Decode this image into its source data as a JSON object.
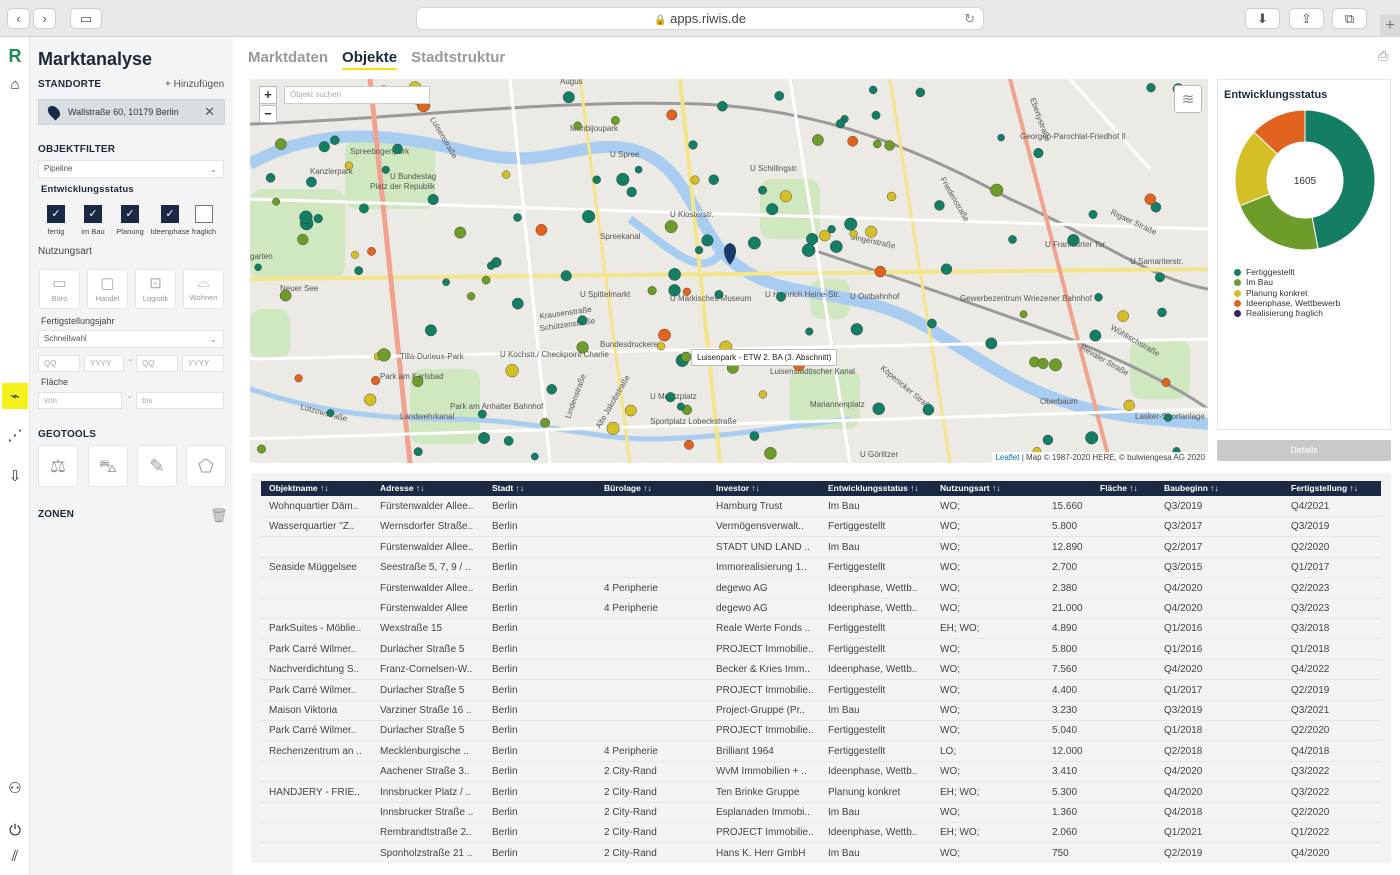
{
  "browser": {
    "url": "apps.riwis.de"
  },
  "sidebar": {
    "title": "Marktanalyse",
    "standorte_label": "STANDORTE",
    "add_label": "+ Hinzufügen",
    "location": "Wallstraße 60, 10179 Berlin",
    "objektfilter_label": "OBJEKTFILTER",
    "pipeline_value": "Pipeline",
    "entwicklungsstatus_label": "Entwicklungsstatus",
    "status_checks": [
      {
        "label": "fertig",
        "checked": true
      },
      {
        "label": "im Bau",
        "checked": true
      },
      {
        "label": "Planung",
        "checked": true
      },
      {
        "label": "Ideenphase",
        "checked": true
      },
      {
        "label": "fraglich",
        "checked": false
      }
    ],
    "nutzungsart_label": "Nutzungsart",
    "usage_tiles": [
      "Büro",
      "Handel",
      "Logistik",
      "Wohnen"
    ],
    "fertigstellungsjahr_label": "Fertigstellungsjahr",
    "schnellwahl_value": "Schnellwahl",
    "qq_placeholder": "QQ",
    "yyyy_placeholder": "YYYY",
    "flaeche_label": "Fläche",
    "von_placeholder": "von",
    "bis_placeholder": "bis",
    "geotools_label": "GEOTOOLS",
    "zonen_label": "ZONEN"
  },
  "tabs": [
    "Marktdaten",
    "Objekte",
    "Stadtstruktur"
  ],
  "active_tab": "Objekte",
  "map": {
    "search_placeholder": "Objekt suchen",
    "zoom_in": "+",
    "zoom_out": "−",
    "tooltip": "Luisenpark - ETW 2. BA (3. Abschnitt)",
    "attribution_leaflet": "Leaflet",
    "attribution_rest": " | Map © 1987-2020 HERE, © bulwiengesa AG 2020",
    "labels": [
      {
        "text": "Luisenstraße"
      },
      {
        "text": "Spreebogenpark"
      },
      {
        "text": "U Bundestag"
      },
      {
        "text": "Kanzlerpark"
      },
      {
        "text": "Platz der Republik"
      },
      {
        "text": "Monbijoupark"
      },
      {
        "text": "U Schillingstr."
      },
      {
        "text": "Friedenstraße"
      },
      {
        "text": "Georgen-Parochial-Friedhof II"
      },
      {
        "text": "Ebertystraße"
      },
      {
        "text": "U Klosterstr."
      },
      {
        "text": "Singerstraße"
      },
      {
        "text": "Rigaer Straße"
      },
      {
        "text": "U Frankfurter Tor"
      },
      {
        "text": "U Samariterstr."
      },
      {
        "text": "Spreekanal"
      },
      {
        "text": "U Spittelmarkt"
      },
      {
        "text": "U Märkisches Museum"
      },
      {
        "text": "U Heinrich Heine-Str."
      },
      {
        "text": "U Ostbahnhof"
      },
      {
        "text": "Gewerbezentrum Wriezener Bahnhof"
      },
      {
        "text": "Wühlischstraße"
      },
      {
        "text": "Neuer See"
      },
      {
        "text": "Krausenstraße"
      },
      {
        "text": "Schützenstraße"
      },
      {
        "text": "Bundesdruckerei"
      },
      {
        "text": "U Kochstr./ Checkpoint Charlie"
      },
      {
        "text": "Tilla-Durieux-Park"
      },
      {
        "text": "Park am Karlsbad"
      },
      {
        "text": "Lützowstraße"
      },
      {
        "text": "Landwehrkanal"
      },
      {
        "text": "Park am Anhalter Bahnhof"
      },
      {
        "text": "U Moritzplatz"
      },
      {
        "text": "Luisenstädtischer Kanal"
      },
      {
        "text": "Mariannenplatz"
      },
      {
        "text": "Köpenicker Straße"
      },
      {
        "text": "Lindenstraße"
      },
      {
        "text": "Alte Jakobstraße"
      },
      {
        "text": "Sportplatz Lobeckstraße"
      },
      {
        "text": "U Görlitzer"
      },
      {
        "text": "Revaler Straße"
      },
      {
        "text": "Lasker-Sportanlage"
      },
      {
        "text": "Oberbaum"
      },
      {
        "text": "Augus"
      },
      {
        "text": "U Spree"
      },
      {
        "text": "garten"
      }
    ]
  },
  "status_panel": {
    "title": "Entwicklungsstatus",
    "total": "1605",
    "legend": [
      {
        "label": "Fertiggestellt",
        "color": "#137e64"
      },
      {
        "label": "Im Bau",
        "color": "#6e9c2a"
      },
      {
        "label": "Planung konkret",
        "color": "#d4bf26"
      },
      {
        "label": "Ideenphase, Wettbewerb",
        "color": "#e2631f"
      },
      {
        "label": "Realisierung fraglich",
        "color": "#3a1f5e"
      }
    ],
    "shares": [
      0.47,
      0.22,
      0.18,
      0.13,
      0.0
    ],
    "details_label": "Details"
  },
  "table": {
    "headers": [
      "Objektname ↑↓",
      "Adresse ↑↓",
      "Stadt ↑↓",
      "Bürolage ↑↓",
      "Investor ↑↓",
      "Entwicklungsstatus ↑↓",
      "Nutzungsart ↑↓",
      "Fläche ↑↓",
      "Baubeginn ↑↓",
      "Fertigstellung ↑↓"
    ],
    "rows": [
      [
        "Wohnquartier Däm..",
        "Fürstenwalder Allee..",
        "Berlin",
        "",
        "Hamburg Trust",
        "Im Bau",
        "WO;",
        "15.660",
        "Q3/2019",
        "Q4/2021"
      ],
      [
        "Wasserquartier \"Z..",
        "Wernsdorfer Straße..",
        "Berlin",
        "",
        "Vermögensverwalt..",
        "Fertiggestellt",
        "WO;",
        "5.800",
        "Q3/2017",
        "Q3/2019"
      ],
      [
        "",
        "Fürstenwalder Allee..",
        "Berlin",
        "",
        "STADT UND LAND ..",
        "Im Bau",
        "WO;",
        "12.890",
        "Q2/2017",
        "Q2/2020"
      ],
      [
        "Seaside Müggelsee",
        "Seestraße 5, 7, 9 / ..",
        "Berlin",
        "",
        "Immorealisierung 1..",
        "Fertiggestellt",
        "WO;",
        "2.700",
        "Q3/2015",
        "Q1/2017"
      ],
      [
        "",
        "Fürstenwalder Allee..",
        "Berlin",
        "4 Peripherie",
        "degewo AG",
        "Ideenphase, Wettb..",
        "WO;",
        "2.380",
        "Q4/2020",
        "Q2/2023"
      ],
      [
        "",
        "Fürstenwalder Allee",
        "Berlin",
        "4 Peripherie",
        "degewo AG",
        "Ideenphase, Wettb..",
        "WO;",
        "21.000",
        "Q4/2020",
        "Q3/2023"
      ],
      [
        "ParkSuites - Möblie..",
        "Wexstraße 15",
        "Berlin",
        "",
        "Reale Werte Fonds ..",
        "Fertiggestellt",
        "EH; WO;",
        "4.890",
        "Q1/2016",
        "Q3/2018"
      ],
      [
        "Park Carré Wilmer..",
        "Durlacher Straße 5",
        "Berlin",
        "",
        "PROJECT Immobilie..",
        "Fertiggestellt",
        "WO;",
        "5.800",
        "Q1/2016",
        "Q1/2018"
      ],
      [
        "Nachverdichtung S..",
        "Franz-Cornelsen-W..",
        "Berlin",
        "",
        "Becker & Kries Imm..",
        "Ideenphase, Wettb..",
        "WO;",
        "7.560",
        "Q4/2020",
        "Q4/2022"
      ],
      [
        "Park Carré Wilmer..",
        "Durlacher Straße 5",
        "Berlin",
        "",
        "PROJECT Immobilie..",
        "Fertiggestellt",
        "WO;",
        "4.400",
        "Q1/2017",
        "Q2/2019"
      ],
      [
        "Maison Viktoria",
        "Varziner Straße 16 ..",
        "Berlin",
        "",
        "Project-Gruppe (Pr..",
        "Im Bau",
        "WO;",
        "3.230",
        "Q3/2019",
        "Q3/2021"
      ],
      [
        "Park Carré Wilmer..",
        "Durlacher Straße 5",
        "Berlin",
        "",
        "PROJECT Immobilie..",
        "Fertiggestellt",
        "WO;",
        "5.040",
        "Q1/2018",
        "Q2/2020"
      ],
      [
        "Rechenzentrum an ..",
        "Mecklenburgische ..",
        "Berlin",
        "4 Peripherie",
        "Brilliant 1964",
        "Fertiggestellt",
        "LO;",
        "12.000",
        "Q2/2018",
        "Q4/2018"
      ],
      [
        "",
        "Aachener Straße 3..",
        "Berlin",
        "2 City-Rand",
        "WvM Immobilien + ..",
        "Ideenphase, Wettb..",
        "WO;",
        "3.410",
        "Q4/2020",
        "Q3/2022"
      ],
      [
        "HANDJERY - FRIE..",
        "Innsbrucker Platz / ..",
        "Berlin",
        "2 City-Rand",
        "Ten Brinke Gruppe",
        "Planung konkret",
        "EH; WO;",
        "5.300",
        "Q4/2020",
        "Q3/2022"
      ],
      [
        "",
        "Innsbrucker Straße ..",
        "Berlin",
        "2 City-Rand",
        "Esplanaden Immobi..",
        "Im Bau",
        "WO;",
        "1.360",
        "Q4/2018",
        "Q2/2020"
      ],
      [
        "",
        "Rembrandtstraße 2..",
        "Berlin",
        "2 City-Rand",
        "PROJECT Immobilie..",
        "Ideenphase, Wettb..",
        "EH; WO;",
        "2.060",
        "Q1/2021",
        "Q1/2022"
      ],
      [
        "",
        "Sponholzstraße 21 ..",
        "Berlin",
        "2 City-Rand",
        "Hans K. Herr GmbH",
        "Im Bau",
        "WO;",
        "750",
        "Q2/2019",
        "Q4/2020"
      ]
    ]
  }
}
